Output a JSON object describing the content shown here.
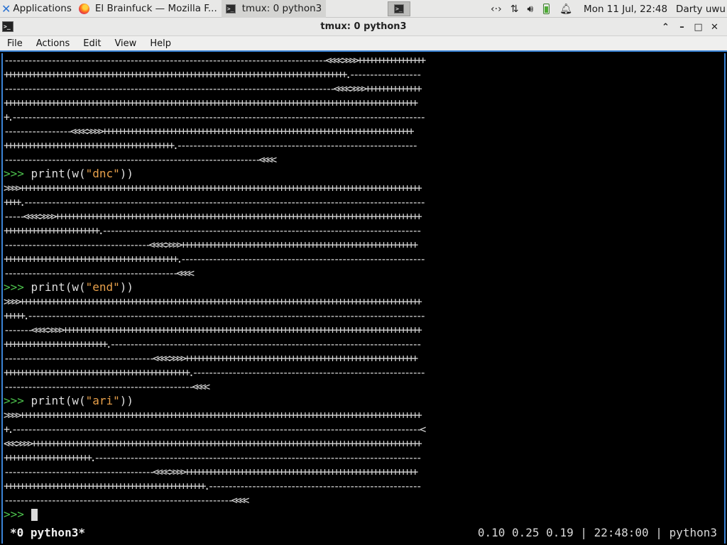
{
  "panel": {
    "apps_label": "Applications",
    "tasks": [
      {
        "label": "El Brainfuck — Mozilla F..."
      },
      {
        "label": "tmux: 0 python3"
      }
    ],
    "clock": "Mon 11 Jul, 22:48",
    "user": "Darty uwu"
  },
  "window": {
    "title": "tmux: 0 python3",
    "menu": [
      "File",
      "Actions",
      "Edit",
      "View",
      "Help"
    ]
  },
  "terminal": {
    "lines": [
      "----------------------------------------------------------------------------------<<<<>>>>+++++++++++++++++",
      "+++++++++++++++++++++++++++++++++++++++++++++++++++++++++++++++++++++++++++++++++++++++.------------------",
      "------------------------------------------------------------------------------------<<<<>>>>++++++++++++++",
      "+++++++++++++++++++++++++++++++++++++++++++++++++++++++++++++++++++++++++++++++++++++++++++++++++++++++++",
      "+.---------------------------------------------------------------------------------------------------------",
      "-----------------<<<<>>>>+++++++++++++++++++++++++++++++++++++++++++++++++++++++++++++++++++++++++++++++",
      "+++++++++++++++++++++++++++++++++++++++++++.-------------------------------------------------------------",
      "-----------------------------------------------------------------<<<<"
    ],
    "blocks": [
      {
        "cmd_prefix": "print(w(",
        "cmd_arg": "\"dnc\"",
        "cmd_suffix": "))",
        "lines": [
          ">>>>++++++++++++++++++++++++++++++++++++++++++++++++++++++++++++++++++++++++++++++++++++++++++++++++++++++",
          "++++.------------------------------------------------------------------------------------------------------",
          "-----<<<<>>>>+++++++++++++++++++++++++++++++++++++++++++++++++++++++++++++++++++++++++++++++++++++++++++++",
          "++++++++++++++++++++++++.---------------------------------------------------------------------------------",
          "-------------------------------------<<<<>>>>++++++++++++++++++++++++++++++++++++++++++++++++++++++++++++",
          "++++++++++++++++++++++++++++++++++++++++++++.--------------------------------------------------------------",
          "--------------------------------------------<<<<"
        ]
      },
      {
        "cmd_prefix": "print(w(",
        "cmd_arg": "\"end\"",
        "cmd_suffix": "))",
        "lines": [
          ">>>>++++++++++++++++++++++++++++++++++++++++++++++++++++++++++++++++++++++++++++++++++++++++++++++++++++++",
          "+++++.-----------------------------------------------------------------------------------------------------",
          "-------<<<<>>>>+++++++++++++++++++++++++++++++++++++++++++++++++++++++++++++++++++++++++++++++++++++++++++",
          "++++++++++++++++++++++++++.-------------------------------------------------------------------------------",
          "--------------------------------------<<<<>>>>+++++++++++++++++++++++++++++++++++++++++++++++++++++++++++",
          "+++++++++++++++++++++++++++++++++++++++++++++++.-----------------------------------------------------------",
          "------------------------------------------------<<<<"
        ]
      },
      {
        "cmd_prefix": "print(w(",
        "cmd_arg": "\"ari\"",
        "cmd_suffix": "))",
        "lines": [
          ">>>>++++++++++++++++++++++++++++++++++++++++++++++++++++++++++++++++++++++++++++++++++++++++++++++++++++++",
          "+.--------------------------------------------------------------------------------------------------------<",
          "<<<>>>>+++++++++++++++++++++++++++++++++++++++++++++++++++++++++++++++++++++++++++++++++++++++++++++++++++",
          "++++++++++++++++++++++.-----------------------------------------------------------------------------------",
          "--------------------------------------<<<<>>>>+++++++++++++++++++++++++++++++++++++++++++++++++++++++++++",
          "+++++++++++++++++++++++++++++++++++++++++++++++++++.------------------------------------------------------",
          "----------------------------------------------------------<<<<"
        ]
      }
    ],
    "prompt": ">>>"
  },
  "status_bar": {
    "left": "*0 python3*",
    "right": "0.10 0.25 0.19 | 22:48:00 | python3"
  }
}
